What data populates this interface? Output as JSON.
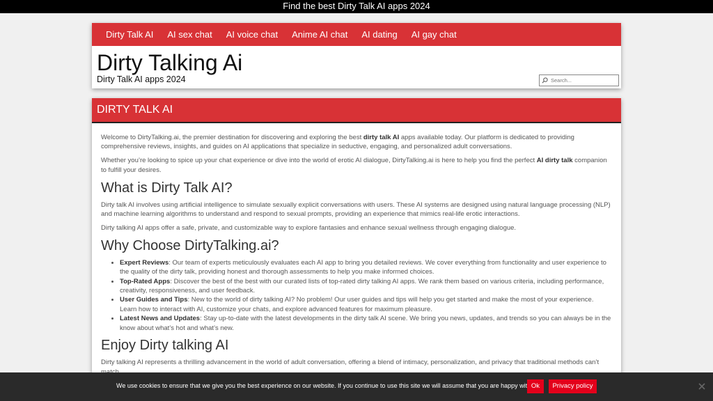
{
  "topbar": {
    "text": "Find the best Dirty Talk AI apps 2024"
  },
  "nav": {
    "items": [
      {
        "label": "Dirty Talk AI"
      },
      {
        "label": "AI sex chat"
      },
      {
        "label": "AI voice chat"
      },
      {
        "label": "Anime AI chat"
      },
      {
        "label": "AI dating"
      },
      {
        "label": "AI gay chat"
      }
    ]
  },
  "site": {
    "title": "Dirty Talking Ai",
    "description": "Dirty Talk AI apps 2024"
  },
  "search": {
    "placeholder": "Search..."
  },
  "content": {
    "heading": "DIRTY TALK AI",
    "intro1": {
      "before": "Welcome to DirtyTalking.ai, the premier destination for discovering and exploring the best ",
      "bold": "dirty talk AI",
      "after": " apps available today. Our platform is dedicated to providing comprehensive reviews, insights, and guides on AI applications that specialize in seductive, engaging, and personalized adult conversations."
    },
    "intro2": {
      "before": "Whether you’re looking to spice up your chat experience or dive into the world of erotic AI dialogue, DirtyTalking.ai is here to help you find the perfect ",
      "bold": "AI dirty talk",
      "after": " companion to fulfill your desires."
    },
    "h_what": "What is Dirty Talk AI?",
    "what_p1": "Dirty talk AI involves using artificial intelligence to simulate sexually explicit conversations with users. These AI systems are designed using natural language processing (NLP) and machine learning algorithms to understand and respond to sexual prompts, providing an experience that mimics real-life erotic interactions.",
    "what_p2": "Dirty talking AI apps offer a safe, private, and customizable way to explore fantasies and enhance sexual wellness through engaging dialogue.",
    "h_why": "Why Choose DirtyTalking.ai?",
    "why_items": [
      {
        "title": "Expert Reviews",
        "text": ": Our team of experts meticulously evaluates each AI app to bring you detailed reviews. We cover everything from functionality and user experience to the quality of the dirty talk, providing honest and thorough assessments to help you make informed choices."
      },
      {
        "title": "Top-Rated Apps",
        "text": ": Discover the best of the best with our curated lists of top-rated dirty talking AI apps. We rank them based on various criteria, including performance, creativity, responsiveness, and user feedback."
      },
      {
        "title": "User Guides and Tips",
        "text": ": New to the world of dirty talking AI? No problem! Our user guides and tips will help you get started and make the most of your experience. Learn how to interact with AI, customize your chats, and explore advanced features for maximum pleasure."
      },
      {
        "title": "Latest News and Updates",
        "text": ": Stay up-to-date with the latest developments in the dirty talk AI scene. We bring you news, updates, and trends so you can always be in the know about what’s hot and what’s new."
      }
    ],
    "h_enjoy": "Enjoy Dirty talking AI",
    "enjoy_p1": "Dirty talking AI represents a thrilling advancement in the world of adult conversation, offering a blend of intimacy, personalization, and privacy that traditional methods can’t match."
  },
  "cookie": {
    "text": "We use cookies to ensure that we give you the best experience on our website. If you continue to use this site we will assume that you are happy with it.",
    "ok_label": "Ok",
    "privacy_label": "Privacy policy"
  },
  "colors": {
    "accent": "#d83236",
    "button": "#e4001b",
    "cookie_bg": "#2a2a2a"
  }
}
